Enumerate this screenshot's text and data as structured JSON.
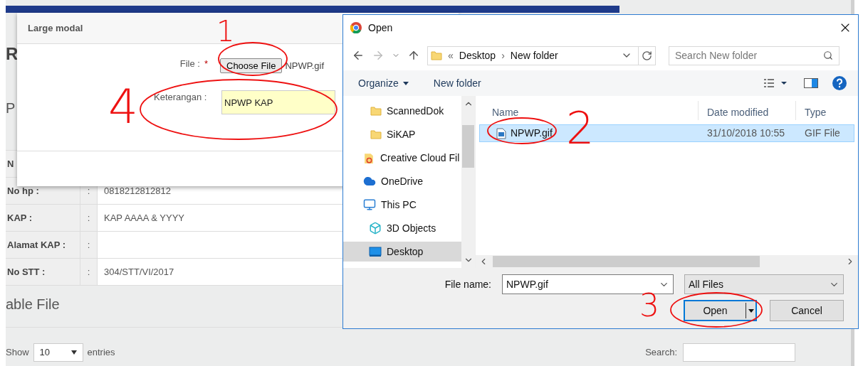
{
  "page": {
    "heading": "R",
    "subheading": "P",
    "table": {
      "rows": [
        {
          "label": "N",
          "sep": "",
          "value": ""
        },
        {
          "label": "No hp :",
          "sep": ":",
          "value": "0818212812812"
        },
        {
          "label": "KAP :",
          "sep": ":",
          "value": "KAP AAAA & YYYY"
        },
        {
          "label": "Alamat KAP :",
          "sep": ":",
          "value": ""
        },
        {
          "label": "No STT :",
          "sep": ":",
          "value": "304/STT/VI/2017"
        }
      ]
    },
    "section_title": "able File",
    "show_label": "Show",
    "page_size": "10",
    "entries_label": "entries",
    "search_label": "Search:"
  },
  "modal": {
    "title": "Large modal",
    "file_label": "File :",
    "required_mark": "*",
    "choose_button": "Choose File",
    "chosen_file": "NPWP.gif",
    "note_label": "Keterangan :",
    "note_value": "NPWP KAP"
  },
  "dialog": {
    "title": "Open",
    "path": [
      "«",
      "Desktop",
      "›",
      "New folder"
    ],
    "search_placeholder": "Search New folder",
    "toolbar": {
      "organize": "Organize",
      "new_folder": "New folder"
    },
    "nav": [
      {
        "label": "ScannedDok",
        "kind": "folder",
        "selected": false
      },
      {
        "label": "SiKAP",
        "kind": "folder",
        "selected": false
      },
      {
        "label": "Creative Cloud Fil",
        "kind": "cloud-files",
        "selected": false
      },
      {
        "label": "OneDrive",
        "kind": "onedrive",
        "selected": false
      },
      {
        "label": "This PC",
        "kind": "pc",
        "selected": false,
        "children": [
          {
            "label": "3D Objects",
            "kind": "objects",
            "selected": false
          },
          {
            "label": "Desktop",
            "kind": "desktop",
            "selected": true
          }
        ]
      }
    ],
    "columns": [
      "Name",
      "Date modified",
      "Type"
    ],
    "files": [
      {
        "name": "NPWP.gif",
        "date": "31/10/2018 10:55",
        "type": "GIF File",
        "selected": true
      }
    ],
    "file_name_label": "File name:",
    "file_name": "NPWP.gif",
    "file_type": "All Files",
    "open_button": "Open",
    "cancel_button": "Cancel"
  },
  "annotations": [
    {
      "label": "1"
    },
    {
      "label": "2"
    },
    {
      "label": "3"
    },
    {
      "label": "4"
    }
  ]
}
